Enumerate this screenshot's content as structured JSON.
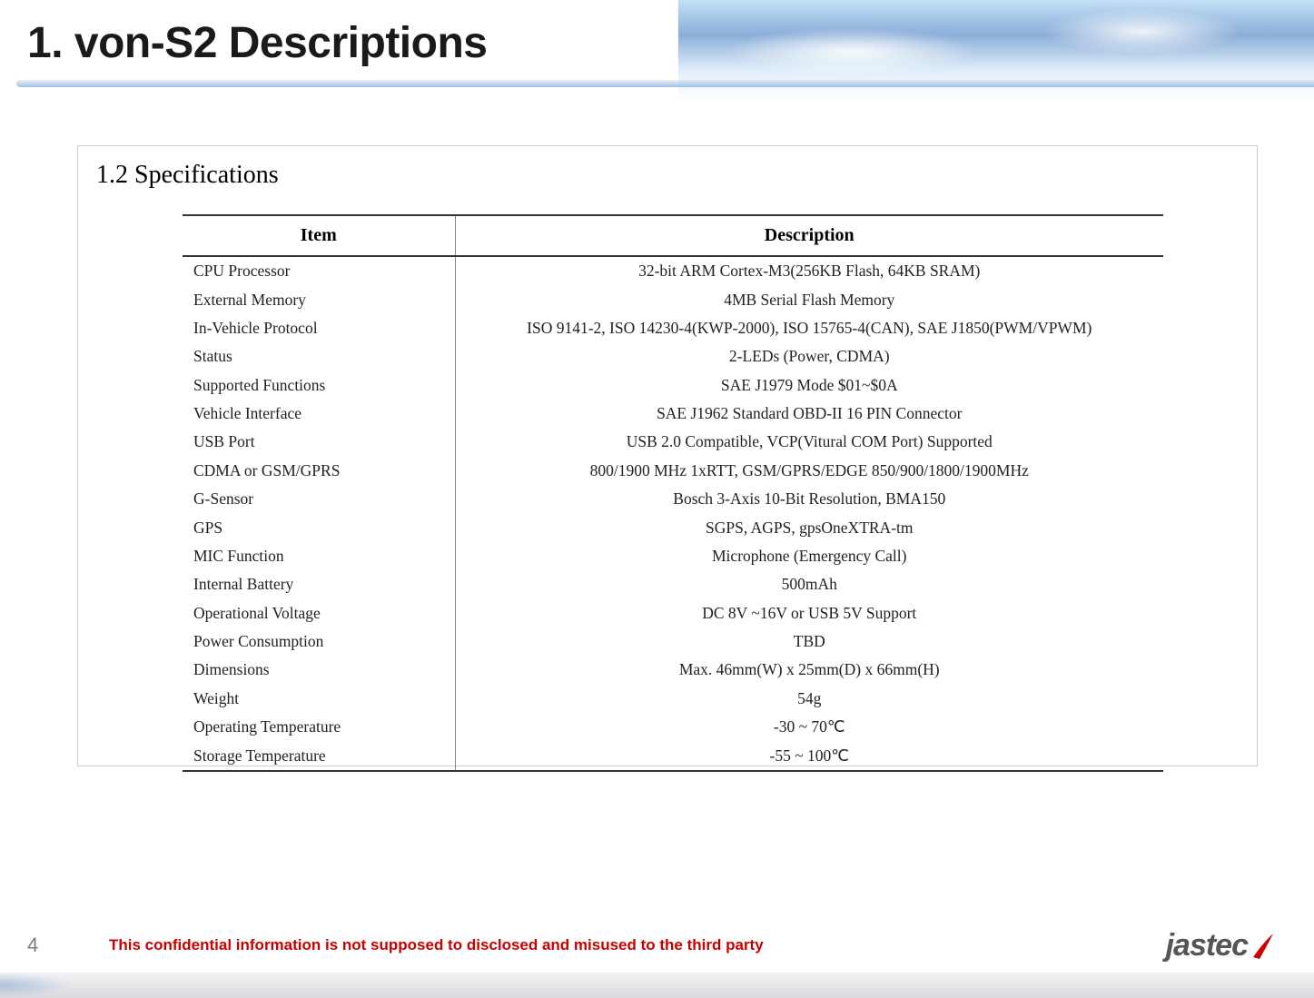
{
  "header": {
    "title": "1. von-S2 Descriptions"
  },
  "section": {
    "title": "1.2 Specifications"
  },
  "table": {
    "headers": {
      "item": "Item",
      "description": "Description"
    },
    "rows": [
      {
        "item": "CPU Processor",
        "description": "32-bit ARM Cortex-M3(256KB Flash, 64KB SRAM)"
      },
      {
        "item": "External Memory",
        "description": "4MB Serial Flash Memory"
      },
      {
        "item": "In-Vehicle Protocol",
        "description": "ISO 9141-2, ISO 14230-4(KWP-2000), ISO 15765-4(CAN), SAE J1850(PWM/VPWM)"
      },
      {
        "item": "Status",
        "description": "2-LEDs (Power, CDMA)"
      },
      {
        "item": "Supported Functions",
        "description": "SAE J1979 Mode $01~$0A"
      },
      {
        "item": "Vehicle Interface",
        "description": "SAE J1962 Standard OBD-II 16 PIN Connector"
      },
      {
        "item": "USB Port",
        "description": "USB 2.0 Compatible, VCP(Vitural COM Port) Supported"
      },
      {
        "item": "CDMA or GSM/GPRS",
        "description": "800/1900 MHz 1xRTT, GSM/GPRS/EDGE 850/900/1800/1900MHz"
      },
      {
        "item": "G-Sensor",
        "description": "Bosch 3-Axis 10-Bit Resolution, BMA150"
      },
      {
        "item": "GPS",
        "description": "SGPS, AGPS, gpsOneXTRA-tm"
      },
      {
        "item": "MIC Function",
        "description": "Microphone (Emergency Call)"
      },
      {
        "item": "Internal Battery",
        "description": "500mAh"
      },
      {
        "item": "Operational Voltage",
        "description": "DC 8V ~16V or USB 5V Support"
      },
      {
        "item": "Power Consumption",
        "description": "TBD"
      },
      {
        "item": "Dimensions",
        "description": "Max. 46mm(W) x 25mm(D) x 66mm(H)"
      },
      {
        "item": "Weight",
        "description": "54g"
      },
      {
        "item": "Operating Temperature",
        "description": "-30 ~ 70℃"
      },
      {
        "item": "Storage Temperature",
        "description": "-55 ~ 100℃"
      }
    ]
  },
  "footer": {
    "page_number": "4",
    "confidential": "This confidential information is not supposed to disclosed and misused to the third party",
    "logo_text": "jastec"
  }
}
